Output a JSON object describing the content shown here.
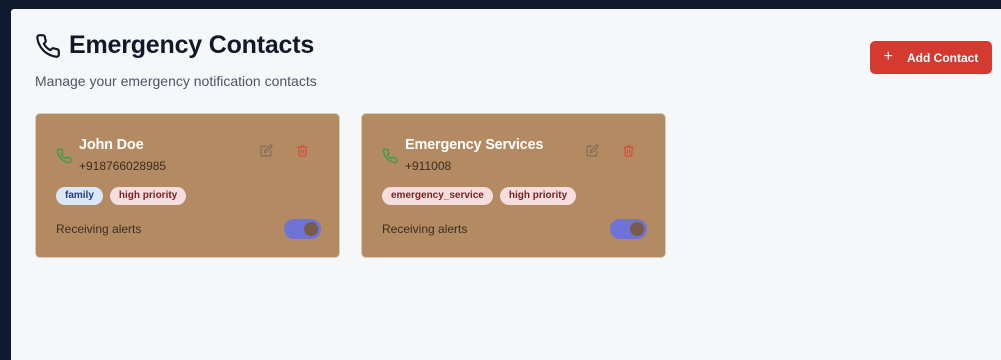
{
  "header": {
    "title": "Emergency Contacts",
    "subtitle": "Manage your emergency notification contacts",
    "icon": "phone-icon"
  },
  "actions": {
    "add_label": "Add Contact",
    "add_icon": "plus-icon",
    "add_color": "#d43a30"
  },
  "contacts": [
    {
      "name": "John Doe",
      "phone": "+918766028985",
      "tags": [
        "family",
        "high priority"
      ],
      "alerts_label": "Receiving alerts",
      "alerts_enabled": true
    },
    {
      "name": "Emergency Services",
      "phone": "+911008",
      "tags": [
        "emergency_service",
        "high priority"
      ],
      "alerts_label": "Receiving alerts",
      "alerts_enabled": true
    }
  ],
  "colors": {
    "card_bg": "#b48a62",
    "toggle_on": "#6f72d6",
    "page_bg": "#f6f7f9",
    "frame_bg": "#0f1a2e"
  }
}
